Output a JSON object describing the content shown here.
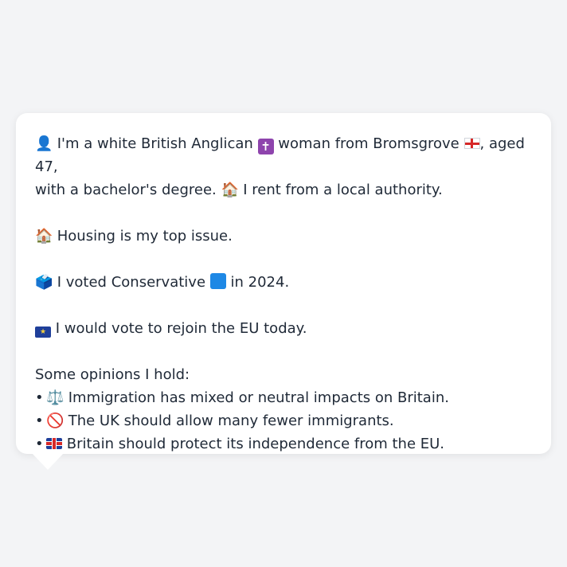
{
  "profile": {
    "intro_icon": "👤",
    "intro_part1": "I'm a white British Anglican",
    "religion_icon": "cross-icon",
    "intro_part2": "woman from Bromsgrove",
    "region_icon": "england-flag-icon",
    "intro_part3": ", aged 47,",
    "intro_line2_part1": "with a bachelor's degree.",
    "housing_icon_inline": "🏠",
    "intro_line2_part2": "I rent from a local authority."
  },
  "top_issue": {
    "icon": "🏠",
    "text": "Housing is my top issue."
  },
  "vote": {
    "icon": "🗳️",
    "text_part1": "I voted Conservative",
    "party_color": "#1e88e5",
    "text_part2": "in 2024."
  },
  "eu": {
    "icon": "eu-flag-icon",
    "text": "I would vote to rejoin the EU today."
  },
  "opinions": {
    "heading": "Some opinions I hold:",
    "items": [
      {
        "icon": "⚖️",
        "text": "Immigration has mixed or neutral impacts on Britain."
      },
      {
        "icon": "🚫",
        "text": "The UK should allow many fewer immigrants."
      },
      {
        "icon": "uk-flag-icon",
        "text": "Britain should protect its independence from the EU."
      }
    ]
  }
}
